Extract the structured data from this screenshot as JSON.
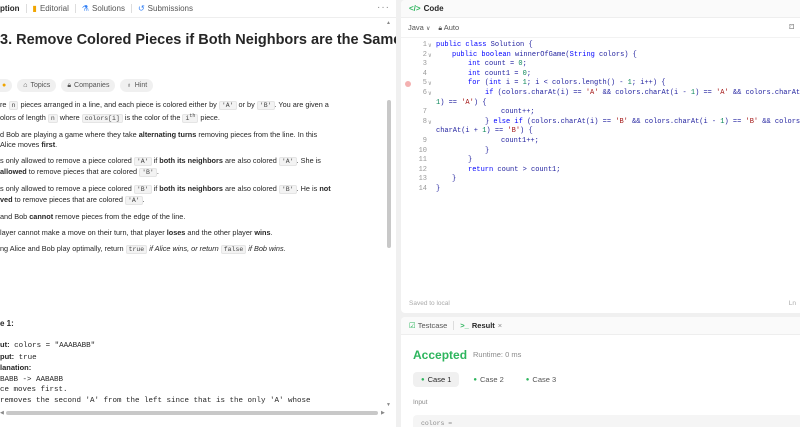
{
  "left_tabs": {
    "description": "ption",
    "editorial": "Editorial",
    "solutions": "Solutions",
    "submissions": "Submissions",
    "more": "···"
  },
  "problem": {
    "title": "3. Remove Colored Pieces if Both Neighbors are the Same Co",
    "tags": [
      "Topics",
      "Companies",
      "Hint"
    ]
  },
  "desc": {
    "p1a": "re ",
    "p1_n": "n",
    "p1b": " pieces arranged in a line, and each piece is colored either by ",
    "p1_A": "'A'",
    "p1c": " or by ",
    "p1_B": "'B'",
    "p1d": ". You are given a",
    "p2a": "olors of length ",
    "p2_n": "n",
    "p2b": " where ",
    "p2_ci": "colors[i]",
    "p2c": " is the color of the ",
    "p2_i": "i",
    "p2_th": "th",
    "p2d": " piece.",
    "p3a": "d Bob are playing a game where they take ",
    "p3_b": "alternating turns",
    "p3b": " removing pieces from the line. In this",
    "p4a": "Alice moves ",
    "p4_b": "first",
    "p4b": ".",
    "p5a": "s only allowed to remove a piece colored ",
    "p5_A": "'A'",
    "p5b": " if ",
    "p5_b": "both its neighbors",
    "p5c": " are also colored ",
    "p5_A2": "'A'",
    "p5d": ". She is",
    "p6_b": "allowed",
    "p6a": " to remove pieces that are colored ",
    "p6_B": "'B'",
    "p6b": ".",
    "p7a": "s only allowed to remove a piece colored ",
    "p7_B": "'B'",
    "p7b": " if ",
    "p7_b": "both its neighbors",
    "p7c": " are also colored ",
    "p7_B2": "'B'",
    "p7d": ". He is ",
    "p7_not": "not",
    "p8_b": "ved",
    "p8a": " to remove pieces that are colored ",
    "p8_A": "'A'",
    "p8b": ".",
    "p9a": " and Bob ",
    "p9_b": "cannot",
    "p9b": " remove pieces from the edge of the line.",
    "p10a": "layer cannot make a move on their turn, that player ",
    "p10_b1": "loses",
    "p10b": " and the other player ",
    "p10_b2": "wins",
    "p10c": ".",
    "p11a": "ng Alice and Bob play optimally, return ",
    "p11_t": "true",
    "p11_i1": " if Alice wins, or return ",
    "p11_f": "false",
    "p11_i2": " if Bob wins."
  },
  "example": {
    "heading": "e 1:",
    "input_label": "ut:",
    "input_val": " colors = \"AAABABB\"",
    "output_label": "put:",
    "output_val": " true",
    "expl_label": "lanation:",
    "line1": "BABB -> AABABB",
    "line2": "ce moves first.",
    "line3": " removes the second 'A' from the left since that is the only 'A' whose"
  },
  "code_panel": {
    "title": "Code",
    "language": "Java",
    "mode": "Auto",
    "saved": "Saved to local",
    "position": "Ln"
  },
  "code": {
    "l1": [
      "public",
      " ",
      "class",
      " Solution {"
    ],
    "l2": [
      "public",
      " ",
      "boolean",
      " winnerOfGame(",
      "String",
      " colors) {"
    ],
    "l3": [
      "int",
      " count = ",
      "0",
      ";"
    ],
    "l4": [
      "int",
      " count1 = ",
      "0",
      ";"
    ],
    "l5": [
      "for",
      " (",
      "int",
      " i = ",
      "1",
      "; i < colors.length() - ",
      "1",
      "; i++) {"
    ],
    "l6": [
      "if",
      " (colors.charAt(i) == ",
      "'A'",
      " && colors.charAt(i - ",
      "1",
      ") == ",
      "'A'",
      " && colors.charAt"
    ],
    "l6b": [
      "1",
      ") == ",
      "'A'",
      ") {"
    ],
    "l7": "count++;",
    "l8": [
      "} ",
      "else",
      " ",
      "if",
      " (colors.charAt(i) == ",
      "'B'",
      " && colors.charAt(i - ",
      "1",
      ") == ",
      "'B'",
      " && colors"
    ],
    "l8b": [
      "charAt(i + ",
      "1",
      ") == ",
      "'B'",
      ") {"
    ],
    "l9": "count1++;",
    "l10": "}",
    "l11": "}",
    "l12": [
      "return",
      " count > count1;"
    ],
    "l13": "}",
    "l14": "}"
  },
  "result_panel": {
    "testcase_tab": "Testcase",
    "result_tab": "Result",
    "status": "Accepted",
    "runtime": "Runtime: 0 ms",
    "cases": [
      "Case 1",
      "Case 2",
      "Case 3"
    ],
    "input_label": "Input",
    "input_val": "colors ="
  }
}
